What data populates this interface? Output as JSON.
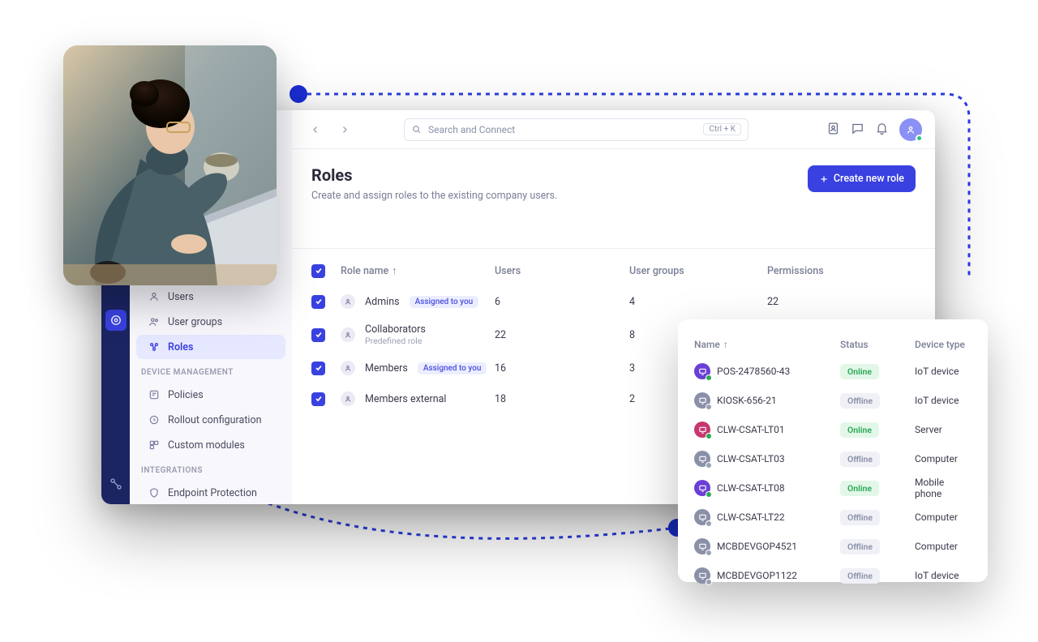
{
  "topbar": {
    "search_placeholder": "Search and Connect",
    "shortcut": "Ctrl + K"
  },
  "page": {
    "title": "Roles",
    "subtitle": "Create and assign roles to the existing company users.",
    "create_button": "Create new role"
  },
  "sidebar": {
    "items_a": [
      {
        "label": "Users"
      },
      {
        "label": "User groups"
      },
      {
        "label": "Roles"
      }
    ],
    "section_device": "DEVICE MANAGEMENT",
    "items_b": [
      {
        "label": "Policies"
      },
      {
        "label": "Rollout configuration"
      },
      {
        "label": "Custom modules"
      }
    ],
    "section_integrations": "INTEGRATIONS",
    "items_c": [
      {
        "label": "Endpoint Protection"
      }
    ]
  },
  "table": {
    "headers": {
      "name": "Role name",
      "users": "Users",
      "groups": "User groups",
      "perms": "Permissions"
    },
    "assigned_badge": "Assigned to you",
    "predefined_sub": "Predefined role",
    "rows": [
      {
        "name": "Admins",
        "badge": true,
        "users": "6",
        "groups": "4",
        "perms": "22"
      },
      {
        "name": "Collaborators",
        "sub": true,
        "users": "22",
        "groups": "8"
      },
      {
        "name": "Members",
        "badge": true,
        "users": "16",
        "groups": "3"
      },
      {
        "name": "Members external",
        "users": "18",
        "groups": "2"
      }
    ]
  },
  "panel": {
    "headers": {
      "name": "Name",
      "status": "Status",
      "type": "Device type"
    },
    "status_online": "Online",
    "status_offline": "Offline",
    "rows": [
      {
        "name": "POS-2478560-43",
        "online": true,
        "type": "IoT device",
        "color": "#6b3fd6"
      },
      {
        "name": "KIOSK-656-21",
        "online": false,
        "type": "IoT device",
        "color": "#8a90a8"
      },
      {
        "name": "CLW-CSAT-LT01",
        "online": true,
        "type": "Server",
        "color": "#c6386f"
      },
      {
        "name": "CLW-CSAT-LT03",
        "online": false,
        "type": "Computer",
        "color": "#8a90a8"
      },
      {
        "name": "CLW-CSAT-LT08",
        "online": true,
        "type": "Mobile phone",
        "color": "#6b3fd6"
      },
      {
        "name": "CLW-CSAT-LT22",
        "online": false,
        "type": "Computer",
        "color": "#8a90a8"
      },
      {
        "name": "MCBDEVGOP4521",
        "online": false,
        "type": "Computer",
        "color": "#8a90a8"
      },
      {
        "name": "MCBDEVGOP1122",
        "online": false,
        "type": "IoT device",
        "color": "#8a90a8"
      }
    ]
  }
}
